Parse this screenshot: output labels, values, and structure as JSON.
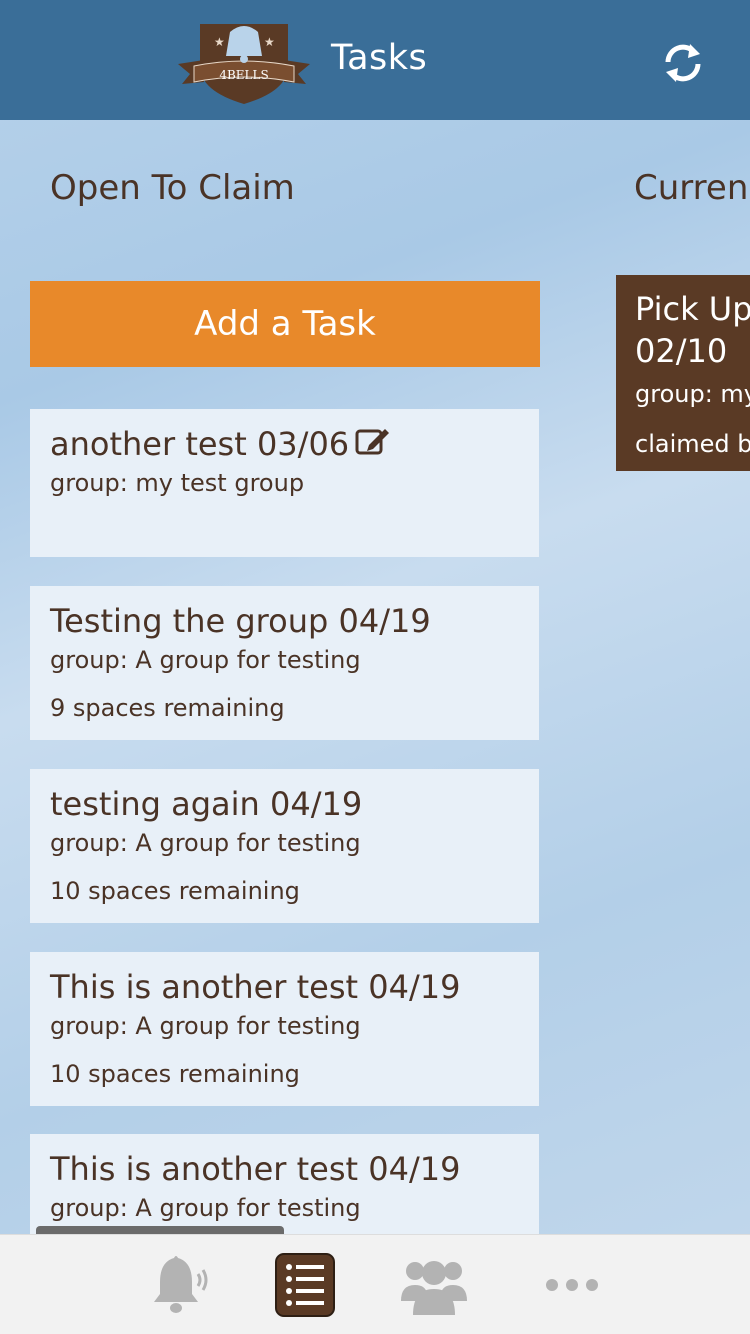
{
  "header": {
    "title": "Tasks",
    "logo_text": "4BELLS",
    "refresh_icon": "refresh-icon"
  },
  "columns": {
    "open_title": "Open To Claim",
    "current_title": "Curren"
  },
  "add_task_label": "Add a Task",
  "open_tasks": [
    {
      "title": "another test 03/06",
      "group": "group: my test group",
      "spaces": "",
      "editable": true
    },
    {
      "title": "Testing the group 04/19",
      "group": "group: A group for testing",
      "spaces": "9 spaces remaining"
    },
    {
      "title": "testing again 04/19",
      "group": "group: A group for testing",
      "spaces": "10 spaces remaining"
    },
    {
      "title": "This is another test 04/19",
      "group": "group: A group for testing",
      "spaces": "10 spaces remaining"
    },
    {
      "title": "This is another test 04/19",
      "group": "group: A group for testing",
      "spaces": ""
    }
  ],
  "current_task": {
    "title_line1": "Pick Up",
    "title_line2": "02/10",
    "group": "group: my",
    "claimed": "claimed b"
  },
  "tabbar": {
    "items": [
      "bell-icon",
      "list-icon",
      "group-icon",
      "more-icon"
    ],
    "active": "list-icon"
  },
  "colors": {
    "header": "#3a6e98",
    "accent": "#e8892a",
    "brown": "#5a3a25",
    "text": "#4a3326"
  }
}
